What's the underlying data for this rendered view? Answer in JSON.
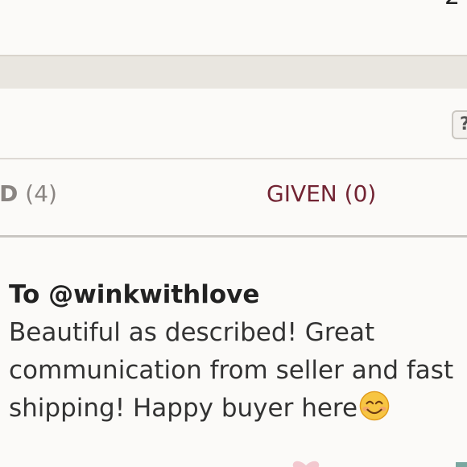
{
  "top_bar": {
    "corner_text": "2"
  },
  "tabs": [
    {
      "label": "ED",
      "count": "(4)",
      "active": false
    },
    {
      "label": "GIVEN (0)",
      "active": true
    }
  ],
  "help_button": {
    "label": "?"
  },
  "review": {
    "recipient": "To @winkwithlove",
    "text": "Beautiful as described! Great communication from seller and fast shipping! Happy buyer here",
    "emoji": "smiling-face-icon"
  },
  "colors": {
    "active_tab": "#722433",
    "inactive_tab": "#8a8582",
    "background": "#fbfaf8",
    "texture_band": "#e9e6e0"
  }
}
